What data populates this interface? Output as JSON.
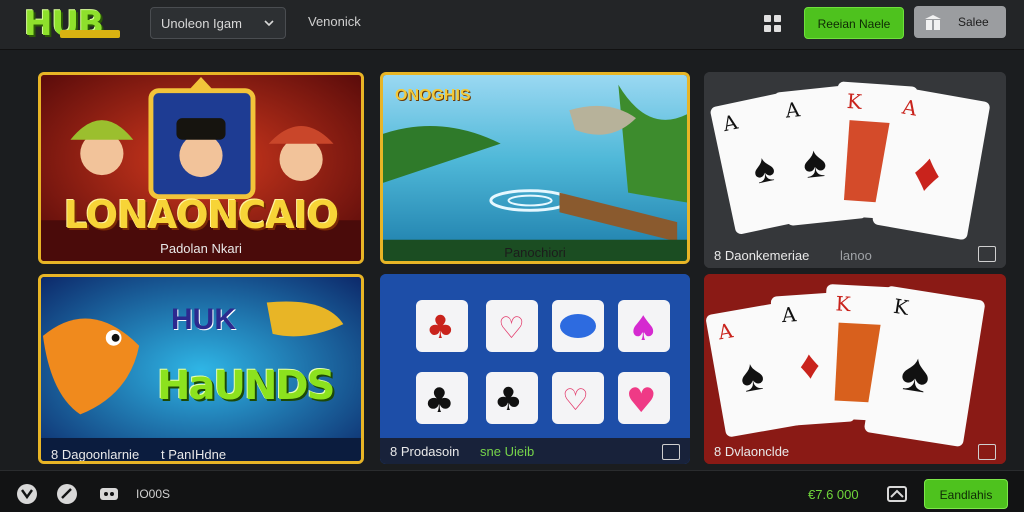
{
  "header": {
    "logo_text": "HUB",
    "select_value": "Unoleon Igam",
    "nav_label": "Venonick",
    "primary_button": "Reeian Naele",
    "secondary_button": "Salee"
  },
  "games": [
    {
      "art_title": "LONAONCAIO",
      "caption": "Padolan Nkari"
    },
    {
      "art_title": "ONOGHIS",
      "caption": "Panochiori"
    },
    {
      "caption": "8 Daonkemeriae",
      "accent": "lanoo"
    },
    {
      "art_title_top": "HUK",
      "art_title_bottom": "HaUNDS",
      "caption": "8 Dagoonlarnie",
      "accent": "t PanIHdne"
    },
    {
      "caption": "8 Prodasoin",
      "accent": "sne Uieib"
    },
    {
      "caption": "8 Dvlaonclde"
    }
  ],
  "footer": {
    "label": "IO00S",
    "balance": "€7.6 000",
    "claim_button": "Eandlahis"
  },
  "colors": {
    "accent_green": "#4ec21e",
    "background": "#1b1d1f",
    "card_red": "#8e1f1a",
    "card_blue": "#1b4aa4"
  },
  "icons": [
    "chevron-down-icon",
    "grid-icon",
    "gift-icon",
    "location-icon",
    "check-circle-icon",
    "chat-icon",
    "wallet-icon",
    "more-icon"
  ]
}
